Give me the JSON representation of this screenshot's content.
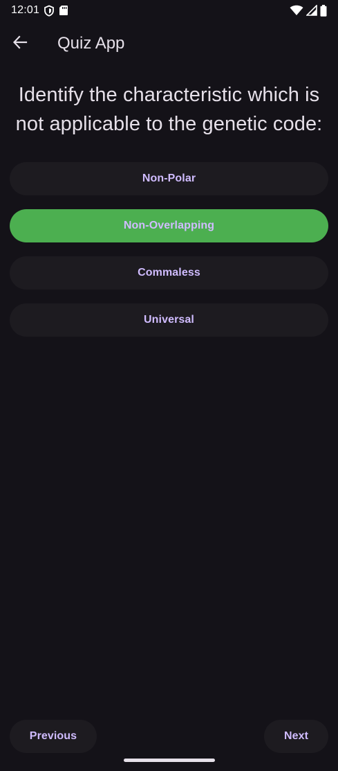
{
  "status_bar": {
    "time": "12:01",
    "icons": [
      "shield-icon",
      "sd-card-icon",
      "wifi-icon",
      "signal-icon",
      "battery-icon"
    ]
  },
  "app_bar": {
    "back_icon": "arrow-back-icon",
    "title": "Quiz App"
  },
  "question": {
    "text": "Identify the characteristic which is not applicable to the genetic code:"
  },
  "options": [
    {
      "label": "Non-Polar",
      "selected": false
    },
    {
      "label": "Non-Overlapping",
      "selected": true
    },
    {
      "label": "Commaless",
      "selected": false
    },
    {
      "label": "Universal",
      "selected": false
    }
  ],
  "navigation": {
    "previous_label": "Previous",
    "next_label": "Next"
  },
  "colors": {
    "background": "#141218",
    "button_surface": "#1D1B20",
    "button_text": "#D0BCFF",
    "selected_option": "#4CAF50",
    "on_surface": "#E6E0E9"
  }
}
